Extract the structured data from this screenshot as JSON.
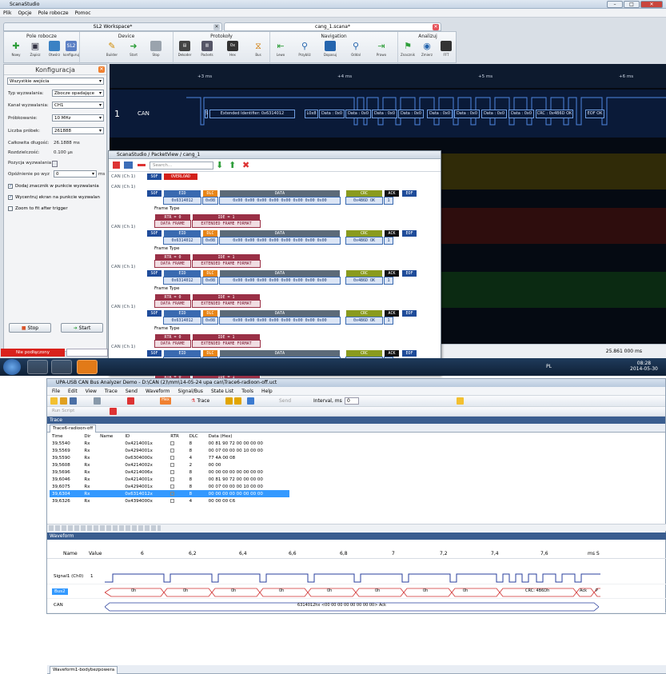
{
  "scana": {
    "title": "ScanaStudio",
    "menu": [
      "Plik",
      "Opcje",
      "Pole robocze",
      "Pomoc"
    ],
    "doc_tabs": [
      "SL2 Workspace*",
      "cang_1.scana*"
    ],
    "ribbon": {
      "groups": [
        "Pole robocze",
        "Device",
        "Protokoły",
        "Navigation",
        "Analizuj"
      ],
      "buttons": [
        "Nowy",
        "Zapisz",
        "Otwórz",
        "konfiguruj",
        "Builder",
        "Start",
        "Stop",
        "Dekoder",
        "Packets",
        "Hex",
        "Bus",
        "Lewo",
        "Przybliż",
        "Dopasuj",
        "Oddal",
        "Prawo",
        "Znacznik",
        "Zmierz",
        "FFT"
      ]
    },
    "config": {
      "title": "Konfiguracja",
      "inputs_select": "Wszystkie wejścia",
      "trigger_type_label": "Typ wyzwalania:",
      "trigger_type": "Zbocze opadające",
      "trigger_channel_label": "Kanał wyzwalania:",
      "trigger_channel": "CH1",
      "sampling_label": "Próbkowanie:",
      "sampling": "10 MHz",
      "samples_label": "Liczba próbek:",
      "samples": "261888",
      "total_label": "Całkowita długość:",
      "total": "26.1888 ms",
      "resolution_label": "Rozdzielczość:",
      "resolution": "0.100 µs",
      "trigger_pos_label": "Pozycja wyzwalania",
      "delay_label": "Opóźnienie po wyz",
      "delay": "0",
      "delay_unit": "ms",
      "chk1": "Dodaj znacznik w punkcie wyzwalania",
      "chk2": "Wycentruj ekran na punkcie wyzwalan",
      "chk3": "Zoom to fit after trigger",
      "stop": "Stop",
      "start": "Start",
      "status": "Nie podłączony"
    },
    "wave": {
      "ticks": [
        "+3 ms",
        "+4 ms",
        "+5 ms",
        "+6 ms"
      ],
      "channel_num": "1",
      "channel_name": "CAN",
      "decodes": [
        "S",
        "Extended Identifier: 0x6314012",
        "L0x8",
        "Data : 0x0",
        "Data : 0x0",
        "Data : 0x0",
        "Data : 0x0",
        "Data : 0x0",
        "Data : 0x0",
        "Data : 0x0",
        "Data : 0x0",
        "CRC : 0x4B6D OK",
        "EOF OK"
      ],
      "status_time": "25.861 000 ms"
    },
    "packetview": {
      "title": "ScanaStudio / PacketView / cang_1",
      "search": "Search...",
      "first_label": "CAN (Ch 1)",
      "sof": "SOF",
      "overload": "OVERLOAD",
      "packet": {
        "label": "CAN (Ch 1)",
        "sof": "SOF",
        "eid": "EID",
        "eid_val": "0x6314012",
        "dlc": "DLC",
        "dlc_val": "0x08",
        "data": "DATA",
        "data_val": "0x00 0x00 0x00 0x00 0x00 0x00 0x00 0x00",
        "crc": "CRC",
        "crc_val": "0x4B6D OK",
        "ack": "ACK",
        "ack_val": "1",
        "eof": "EOF",
        "frame_type": "Frame Type",
        "rtr": "RTR = 0",
        "ide": "IDE = 1",
        "data_frame": "DATA FRAME",
        "ext_frame": "EXTENDED FRAME FORMAT"
      }
    },
    "tray": {
      "lang": "PL",
      "time": "08:28",
      "date": "2014-05-30"
    }
  },
  "upa": {
    "title": "UPA-USB CAN Bus Analyzer Demo - D:\\CAN (2)\\mm\\14-05-24 upa can\\Trace6-radioon-off.uct",
    "menu": [
      "File",
      "Edit",
      "View",
      "Trace",
      "Send",
      "Waveform",
      "Signal/Bus",
      "State List",
      "Tools",
      "Help"
    ],
    "toolbar": {
      "trace": "Trace",
      "send": "Send",
      "interval": "Interval, ms",
      "interval_val": "0",
      "run_script": "Run Script"
    },
    "trace_section": "Trace",
    "trace_tab": "Trace6-radioon-off",
    "columns": [
      "Time",
      "Dir",
      "Name",
      "ID",
      "RTR",
      "DLC",
      "Data (Hex)"
    ],
    "rows": [
      [
        "39,5540",
        "Rx",
        "",
        "0x4214001x",
        "",
        "8",
        "00 81 90 72 00 00 00 00"
      ],
      [
        "39,5569",
        "Rx",
        "",
        "0x4294001x",
        "",
        "8",
        "00 07 00 00 00 10 00 00"
      ],
      [
        "39,5590",
        "Rx",
        "",
        "0x6304000x",
        "",
        "4",
        "77 4A 00 08"
      ],
      [
        "39,5608",
        "Rx",
        "",
        "0x4214002x",
        "",
        "2",
        "00 00"
      ],
      [
        "39,5696",
        "Rx",
        "",
        "0x4214006x",
        "",
        "8",
        "00 00 00 00 00 00 00 00"
      ],
      [
        "39,6046",
        "Rx",
        "",
        "0x4214001x",
        "",
        "8",
        "00 81 90 72 00 00 00 00"
      ],
      [
        "39,6075",
        "Rx",
        "",
        "0x4294001x",
        "",
        "8",
        "00 07 00 00 00 10 00 00"
      ],
      [
        "39,6304",
        "Rx",
        "",
        "0x6314012x",
        "",
        "8",
        "00 00 00 00 00 00 00 00"
      ],
      [
        "39,6326",
        "Rx",
        "",
        "0x4394000x",
        "",
        "4",
        "00 00 00 C6"
      ]
    ],
    "waveform_section": "Waveform",
    "waveform_tab": "Waveform1-bodybezpowera",
    "wf_cols": [
      "Name",
      "Value"
    ],
    "wf_ticks": [
      "6",
      "6,2",
      "6,4",
      "6,6",
      "6,8",
      "7",
      "7,2",
      "7,4",
      "7,6"
    ],
    "wf_unit": "ms S",
    "signals": [
      {
        "name": "Signal1 (Ch0)",
        "value": "1"
      },
      {
        "name": "Bus2",
        "value": ""
      },
      {
        "name": "CAN",
        "value": ""
      }
    ],
    "bus_vals": [
      "0h",
      "0h",
      "0h",
      "0h",
      "0h",
      "0h",
      "0h",
      "0h",
      "CRC: 4B6Dh",
      "Ack",
      "P"
    ],
    "can_text": "6314012hx <00 00 00 00 00 00 00 00> Ack"
  }
}
